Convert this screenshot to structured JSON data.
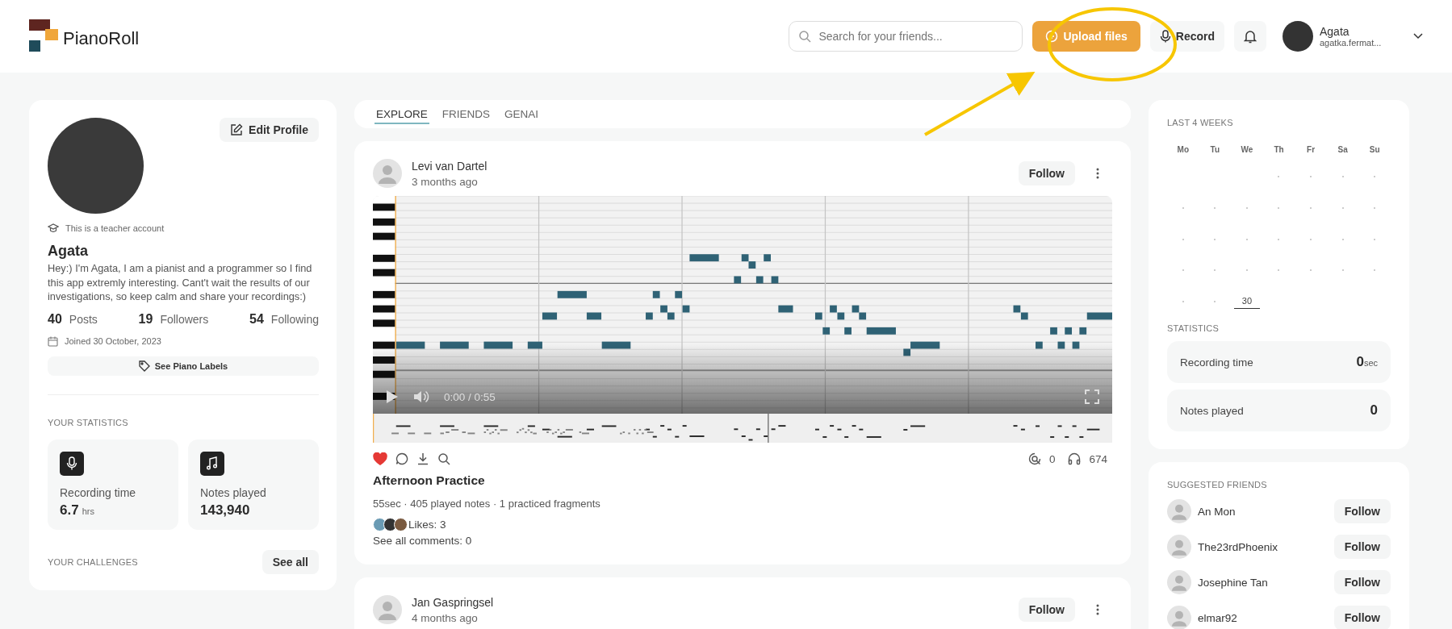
{
  "header": {
    "logo_text": "PianoRoll",
    "search": {
      "placeholder": "Search for your friends..."
    },
    "upload_button": "Upload files",
    "record_button": "Record",
    "user": {
      "name": "Agata",
      "handle": "agatka.fermat..."
    }
  },
  "profile": {
    "edit_button": "Edit Profile",
    "account_note": "This is a teacher account",
    "name": "Agata",
    "bio": "Hey:) I'm Agata, I am a pianist and a programmer so I find this app extremly interesting. Cant't wait the results of our investigations, so keep calm and share your recordings:)",
    "counts": [
      {
        "value": "40",
        "label": "Posts"
      },
      {
        "value": "19",
        "label": "Followers"
      },
      {
        "value": "54",
        "label": "Following"
      }
    ],
    "joined": "Joined 30 October, 2023",
    "labels_button": "See Piano Labels"
  },
  "your_statistics": {
    "heading": "YOUR STATISTICS",
    "cards": [
      {
        "kind": "mic",
        "label": "Recording time",
        "value": "6.7",
        "unit": "hrs"
      },
      {
        "kind": "note",
        "label": "Notes played",
        "value": "143,940"
      }
    ]
  },
  "your_challenges": {
    "heading": "YOUR CHALLENGES",
    "button": "See all"
  },
  "feed_tabs": [
    {
      "label": "EXPLORE",
      "selected": true
    },
    {
      "label": "FRIENDS",
      "selected": false
    },
    {
      "label": "GENAI",
      "selected": false
    }
  ],
  "posts": [
    {
      "author": "Levi van Dartel",
      "time": "3 months ago",
      "follow": "Follow",
      "player_time": "0:00 / 0:55",
      "liked": true,
      "challenges": "0",
      "listens": "674",
      "title": "Afternoon Practice",
      "summary": "55sec · 405 played notes · 1 practiced fragments",
      "likes": "Likes: 3",
      "comments_link": "See all comments: 0"
    },
    {
      "author": "Jan Gaspringsel",
      "time": "4 months ago",
      "follow": "Follow"
    }
  ],
  "calendar": {
    "heading": "LAST 4 WEEKS",
    "weekdays": [
      "Mo",
      "Tu",
      "We",
      "Th",
      "Fr",
      "Sa",
      "Su"
    ],
    "weeks": [
      [
        {
          "kind": "empty"
        },
        {
          "kind": "empty"
        },
        {
          "kind": "empty"
        },
        {
          "kind": "dot"
        },
        {
          "kind": "dot"
        },
        {
          "kind": "dot"
        },
        {
          "kind": "dot"
        }
      ],
      [
        {
          "kind": "dot"
        },
        {
          "kind": "dot"
        },
        {
          "kind": "dot"
        },
        {
          "kind": "dot"
        },
        {
          "kind": "dot"
        },
        {
          "kind": "dot"
        },
        {
          "kind": "dot"
        }
      ],
      [
        {
          "kind": "dot"
        },
        {
          "kind": "dot"
        },
        {
          "kind": "dot"
        },
        {
          "kind": "dot"
        },
        {
          "kind": "dot"
        },
        {
          "kind": "dot"
        },
        {
          "kind": "dot"
        }
      ],
      [
        {
          "kind": "dot"
        },
        {
          "kind": "dot"
        },
        {
          "kind": "dot"
        },
        {
          "kind": "dot"
        },
        {
          "kind": "dot"
        },
        {
          "kind": "dot"
        },
        {
          "kind": "dot"
        }
      ],
      [
        {
          "kind": "dot"
        },
        {
          "kind": "dot"
        },
        {
          "kind": "day",
          "label": "30",
          "selected": true
        },
        {
          "kind": "empty"
        },
        {
          "kind": "empty"
        },
        {
          "kind": "empty"
        },
        {
          "kind": "empty"
        }
      ]
    ]
  },
  "statistics": {
    "heading": "STATISTICS",
    "rows": [
      {
        "label": "Recording time",
        "value": "0",
        "unit": "sec"
      },
      {
        "label": "Notes played",
        "value": "0"
      }
    ]
  },
  "suggested_friends": {
    "heading": "SUGGESTED FRIENDS",
    "items": [
      {
        "name": "An Mon",
        "button": "Follow"
      },
      {
        "name": "The23rdPhoenix",
        "button": "Follow"
      },
      {
        "name": "Josephine Tan",
        "button": "Follow"
      },
      {
        "name": "elmar92",
        "button": "Follow"
      }
    ]
  }
}
